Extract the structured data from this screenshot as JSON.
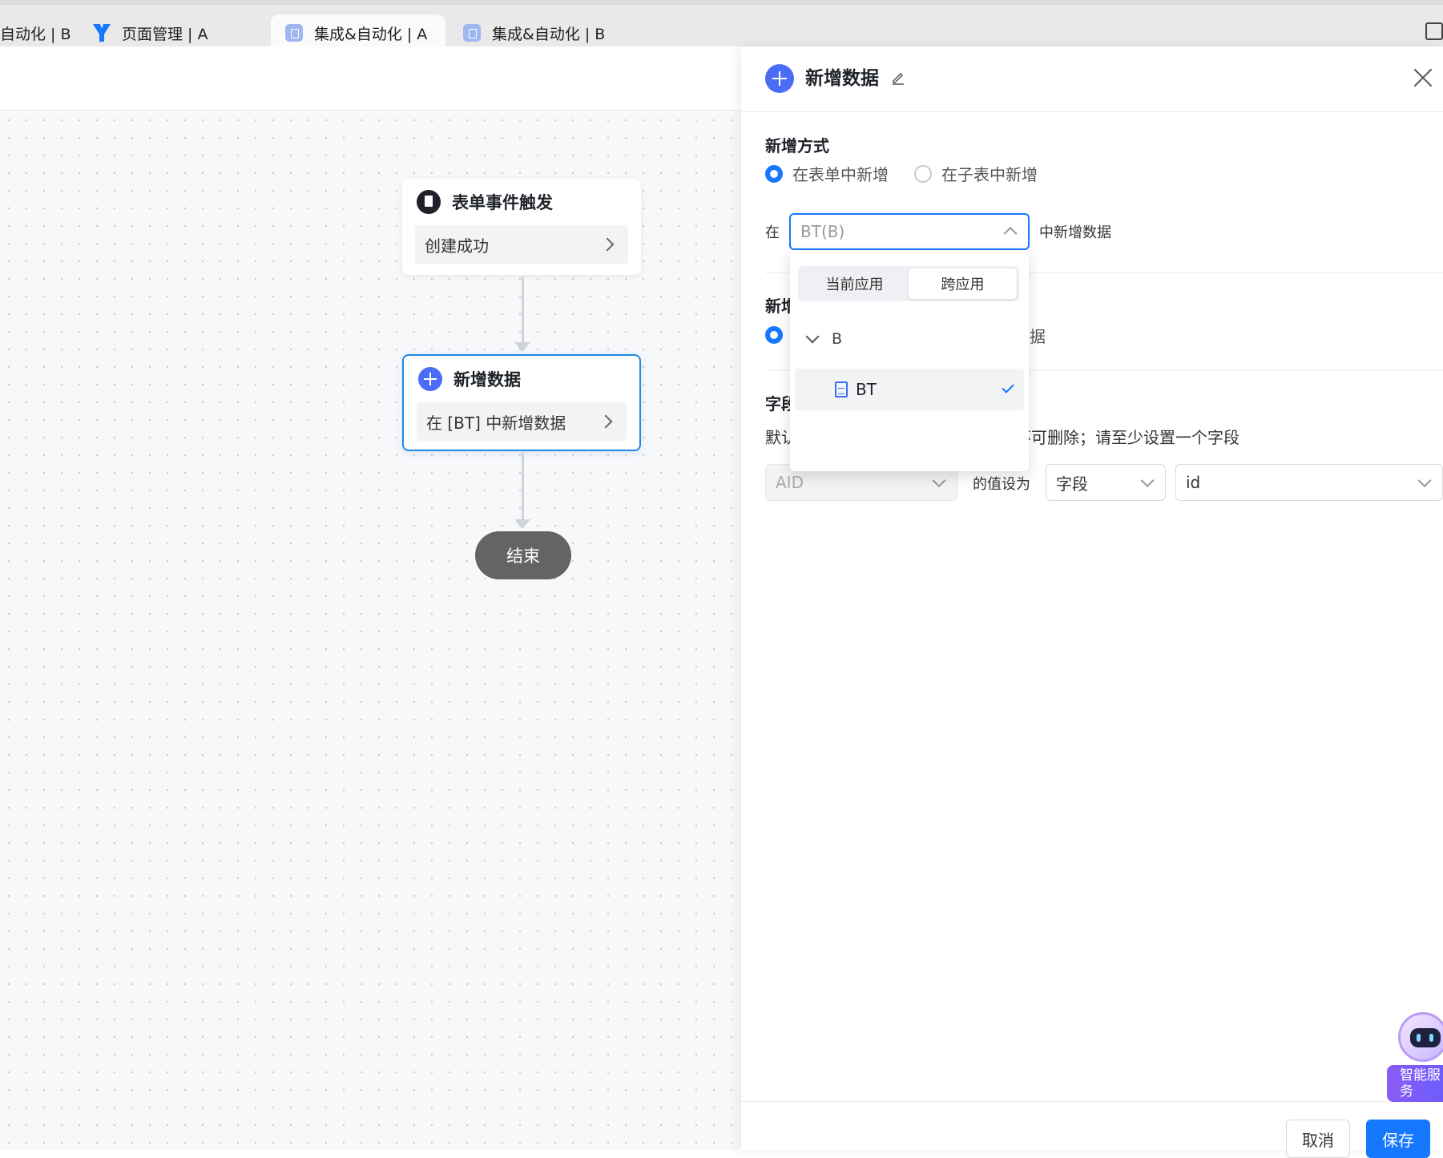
{
  "tabs": [
    {
      "label": "自动化 | B",
      "icon": "none",
      "active": false
    },
    {
      "label": "页面管理 | A",
      "icon": "yida-logo-icon",
      "active": false
    },
    {
      "label": "集成&自动化 | A",
      "icon": "doc-app-icon",
      "active": true
    },
    {
      "label": "集成&自动化 | B",
      "icon": "doc-app-icon",
      "active": false
    }
  ],
  "flow": {
    "trigger": {
      "title": "表单事件触发",
      "body": "创建成功"
    },
    "add_node": {
      "title": "新增数据",
      "body": "在 [BT] 中新增数据"
    },
    "end_label": "结束"
  },
  "panel": {
    "title": "新增数据",
    "add_mode": {
      "title": "新增方式",
      "option_form": "在表单中新增",
      "option_subform": "在子表中新增",
      "selected": "在表单中新增"
    },
    "in_prefix": "在",
    "target_select_value": "BT(B)",
    "in_suffix": "中新增数据",
    "section2_title_visible": "新",
    "section2_title_fragment": "增",
    "section2_option_fragment": "据",
    "field_section_title_visible": "字",
    "field_section_title_fragment": "段",
    "field_desc_visible_left": "默认",
    "field_desc_visible_right": "不可删除；请至少设置一个字段",
    "field_row": {
      "field_select": "AID",
      "set_label": "的值设为",
      "type_select": "字段",
      "value_select": "id"
    },
    "footer": {
      "cancel": "取消",
      "save": "保存"
    }
  },
  "dropdown": {
    "segments": [
      "当前应用",
      "跨应用"
    ],
    "active_segment": "跨应用",
    "group": "B",
    "items": [
      {
        "label": "BT",
        "selected": true
      }
    ]
  },
  "assistant": {
    "label": "智能服务"
  },
  "colors": {
    "primary": "#1677ff",
    "node_icon": "#4a6cf7",
    "end_node": "#646464"
  }
}
